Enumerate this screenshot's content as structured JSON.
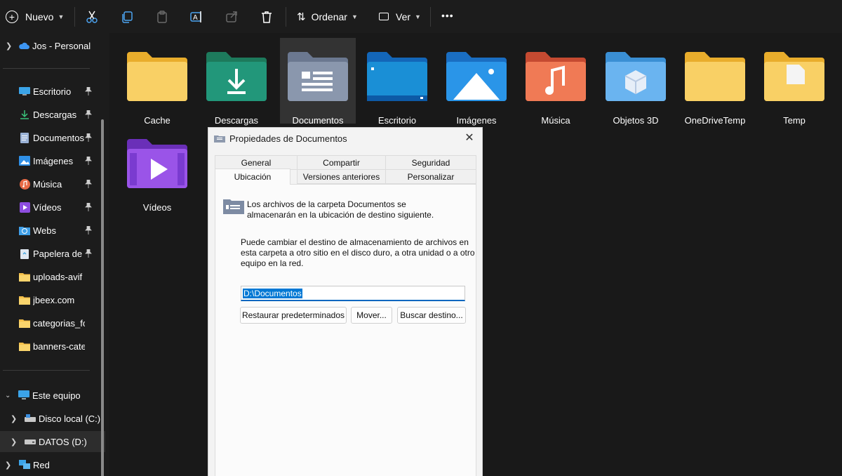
{
  "toolbar": {
    "new_label": "Nuevo",
    "sort_label": "Ordenar",
    "view_label": "Ver",
    "more_label": "•••"
  },
  "sidebar": {
    "top_item": "Jos - Personal",
    "quick_access": [
      {
        "label": "Escritorio",
        "icon": "desktop-icon"
      },
      {
        "label": "Descargas",
        "icon": "download-icon"
      },
      {
        "label": "Documentos",
        "icon": "document-icon"
      },
      {
        "label": "Imágenes",
        "icon": "image-icon"
      },
      {
        "label": "Música",
        "icon": "music-icon"
      },
      {
        "label": "Vídeos",
        "icon": "video-icon"
      },
      {
        "label": "Webs",
        "icon": "globe-icon"
      },
      {
        "label": "Papelera de r",
        "icon": "recycle-bin-icon"
      },
      {
        "label": "uploads-avif",
        "icon": "folder-icon"
      },
      {
        "label": "jbeex.com",
        "icon": "folder-icon"
      },
      {
        "label": "categorias_fonde",
        "icon": "folder-icon"
      },
      {
        "label": "banners-categor",
        "icon": "folder-icon"
      }
    ],
    "this_pc": "Este equipo",
    "drive_c": "Disco local (C:)",
    "drive_d": "DATOS (D:)",
    "network": "Red"
  },
  "folders": [
    {
      "name": "Cache",
      "icon": "folder-icon"
    },
    {
      "name": "Descargas",
      "icon": "download-folder-icon"
    },
    {
      "name": "Documentos",
      "icon": "documents-folder-icon"
    },
    {
      "name": "Escritorio",
      "icon": "desktop-folder-icon"
    },
    {
      "name": "Imágenes",
      "icon": "pictures-folder-icon"
    },
    {
      "name": "Música",
      "icon": "music-folder-icon"
    },
    {
      "name": "Objetos 3D",
      "icon": "3d-objects-folder-icon"
    },
    {
      "name": "OneDriveTemp",
      "icon": "folder-icon"
    },
    {
      "name": "Temp",
      "icon": "folder-icon"
    },
    {
      "name": "Vídeos",
      "icon": "videos-folder-icon"
    }
  ],
  "dialog": {
    "title": "Propiedades de Documentos",
    "close": "✕",
    "tabs_row1": [
      "General",
      "Compartir",
      "Seguridad"
    ],
    "tabs_row2": [
      "Ubicación",
      "Versiones anteriores",
      "Personalizar"
    ],
    "intro_line1": "Los archivos de la carpeta Documentos se",
    "intro_line2": "almacenarán en la ubicación de destino siguiente.",
    "desc_line1": "Puede cambiar el destino de almacenamiento de archivos en",
    "desc_line2": "esta carpeta a otro sitio en el disco duro, a otra unidad o a otro",
    "desc_line3": "equipo en la red.",
    "path_value": "D:\\Documentos",
    "restore_button": "Restaurar predeterminados",
    "move_button": "Mover...",
    "find_button": "Buscar destino..."
  },
  "colors": {
    "accent": "#0078d4",
    "folder_yellow": "#f8c94a"
  }
}
